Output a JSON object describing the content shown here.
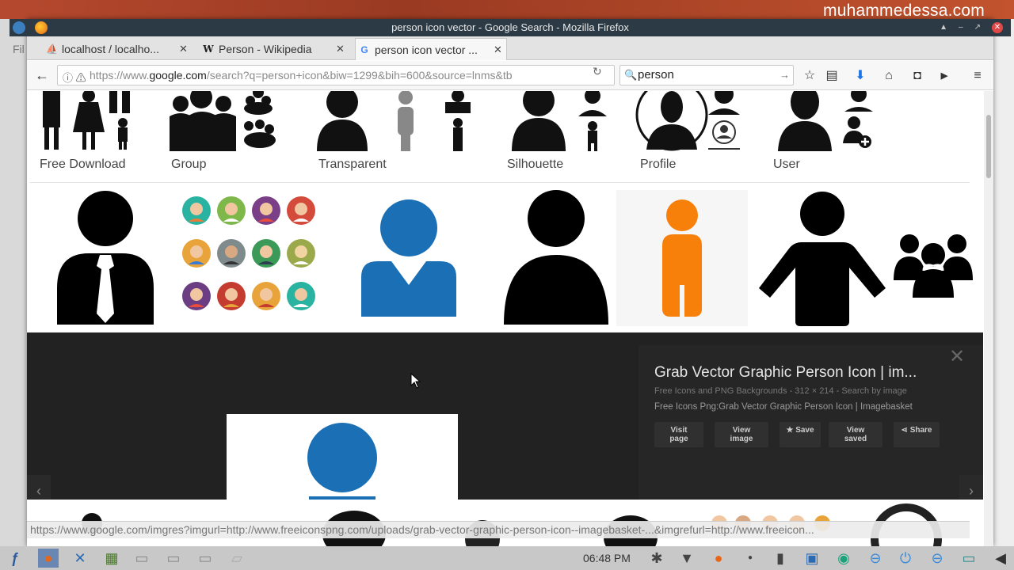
{
  "watermark": "muhammedessa.com",
  "window": {
    "title": "person icon vector - Google Search - Mozilla Firefox"
  },
  "tabs": [
    {
      "label": "localhost / localho...",
      "icon": "phpmyadmin-icon"
    },
    {
      "label": "Person - Wikipedia",
      "icon": "wikipedia-icon"
    },
    {
      "label": "person icon vector ...",
      "icon": "google-icon"
    }
  ],
  "nav": {
    "url_prefix": "https://www.",
    "url_domain": "google.com",
    "url_rest": "/search?q=person+icon&biw=1299&bih=600&source=lnms&tb",
    "search_value": "person"
  },
  "chips": [
    {
      "label": "Free Download"
    },
    {
      "label": "Group"
    },
    {
      "label": "Transparent"
    },
    {
      "label": "Silhouette"
    },
    {
      "label": "Profile"
    },
    {
      "label": "User"
    }
  ],
  "viewer": {
    "title": "Grab Vector Graphic Person Icon | im...",
    "meta": "Free Icons and PNG Backgrounds - 312 × 214 - Search by image",
    "desc": "Free Icons Png:Grab Vector Graphic Person Icon | Imagebasket",
    "buttons": {
      "visit_1": "Visit",
      "visit_2": "page",
      "view_1": "View",
      "view_2": "image",
      "save": "Save",
      "saved_1": "View",
      "saved_2": "saved",
      "share": "Share"
    }
  },
  "status_url": "https://www.google.com/imgres?imgurl=http://www.freeiconspng.com/uploads/grab-vector-graphic-person-icon--imagebasket-...&imgrefurl=http://www.freeicon...",
  "taskbar": {
    "clock": "06:48 PM"
  },
  "colors": {
    "blue_person": "#1a6fb5",
    "orange_person": "#f7800a",
    "viewer_bg": "#222222"
  }
}
